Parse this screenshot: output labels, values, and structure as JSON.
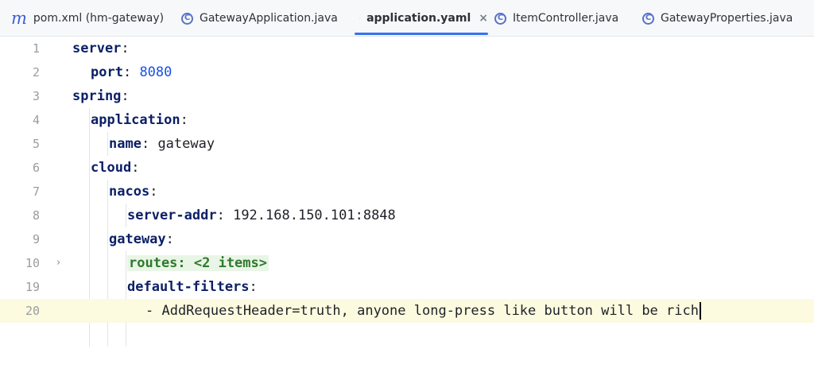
{
  "tabs": [
    {
      "label": "pom.xml (hm-gateway)",
      "icon": "maven-icon",
      "active": false
    },
    {
      "label": "GatewayApplication.java",
      "icon": "class-icon",
      "active": false
    },
    {
      "label": "application.yaml",
      "icon": "yaml-icon",
      "active": true
    },
    {
      "label": "ItemController.java",
      "icon": "class-icon",
      "active": false
    },
    {
      "label": "GatewayProperties.java",
      "icon": "class-icon",
      "active": false
    }
  ],
  "icons": {
    "maven_glyph": "m",
    "class_glyph": "C",
    "close_glyph": "×",
    "fold_glyph": "›"
  },
  "colors": {
    "accent": "#3574f0",
    "key": "#0b1f66",
    "number": "#1750eb",
    "current_line": "#fcfadf",
    "folded_bg": "#e9f5e6"
  },
  "editor": {
    "lines": [
      {
        "number": "1",
        "key": "server",
        "sep": ":"
      },
      {
        "number": "2",
        "key": "port",
        "sep": ": ",
        "value": "8080"
      },
      {
        "number": "3",
        "key": "spring",
        "sep": ":"
      },
      {
        "number": "4",
        "key": "application",
        "sep": ":"
      },
      {
        "number": "5",
        "key": "name",
        "sep": ": ",
        "value": "gateway"
      },
      {
        "number": "6",
        "key": "cloud",
        "sep": ":"
      },
      {
        "number": "7",
        "key": "nacos",
        "sep": ":"
      },
      {
        "number": "8",
        "key": "server-addr",
        "sep": ": ",
        "value": "192.168.150.101:8848"
      },
      {
        "number": "9",
        "key": "gateway",
        "sep": ":"
      },
      {
        "number": "10",
        "folded": "routes: <2 items>"
      },
      {
        "number": "19",
        "key": "default-filters",
        "sep": ":"
      },
      {
        "number": "20",
        "value": "- AddRequestHeader=truth, anyone long-press like button will be rich"
      }
    ]
  }
}
